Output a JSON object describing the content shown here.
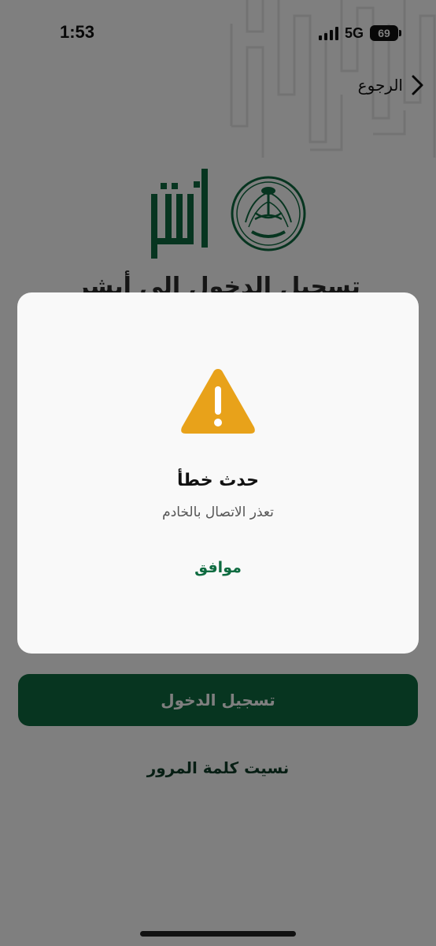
{
  "status_bar": {
    "time": "1:53",
    "network": "5G",
    "battery": "69"
  },
  "nav": {
    "back_label": "الرجوع"
  },
  "page": {
    "heading": "تسجيل الدخول إلى أبشر",
    "login_button": "تسجيل الدخول",
    "forgot_password": "نسيت كلمة المرور"
  },
  "alert": {
    "icon": "warning-icon",
    "title": "حدث خطأ",
    "message": "تعذر الاتصال بالخادم",
    "ok_label": "موافق"
  },
  "colors": {
    "brand_green": "#0e6b40",
    "warning": "#e8a21a",
    "overlay": "rgba(0,0,0,0.5)"
  }
}
